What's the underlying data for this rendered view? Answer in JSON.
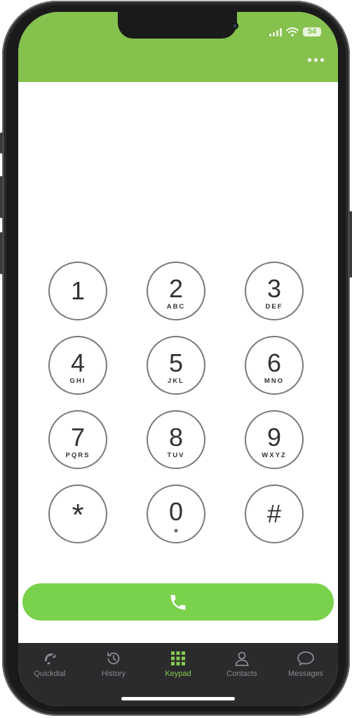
{
  "status_bar": {
    "battery": "54"
  },
  "header": {
    "menu_icon": "more-icon"
  },
  "keypad": {
    "keys": [
      {
        "digit": "1",
        "letters": ""
      },
      {
        "digit": "2",
        "letters": "ABC"
      },
      {
        "digit": "3",
        "letters": "DEF"
      },
      {
        "digit": "4",
        "letters": "GHI"
      },
      {
        "digit": "5",
        "letters": "JKL"
      },
      {
        "digit": "6",
        "letters": "MNO"
      },
      {
        "digit": "7",
        "letters": "PQRS"
      },
      {
        "digit": "8",
        "letters": "TUV"
      },
      {
        "digit": "9",
        "letters": "WXYZ"
      },
      {
        "digit": "*",
        "letters": ""
      },
      {
        "digit": "0",
        "letters": "+"
      },
      {
        "digit": "#",
        "letters": ""
      }
    ]
  },
  "call_button": {
    "icon": "phone-icon",
    "color": "#7ad14b"
  },
  "tabs": [
    {
      "label": "Quickdial",
      "icon": "quickdial-icon"
    },
    {
      "label": "History",
      "icon": "history-icon"
    },
    {
      "label": "Keypad",
      "icon": "keypad-grid-icon",
      "active": true
    },
    {
      "label": "Contacts",
      "icon": "contacts-icon"
    },
    {
      "label": "Messages",
      "icon": "messages-icon"
    }
  ],
  "colors": {
    "header": "#85c14d",
    "accent": "#86c84f",
    "tabbar": "#2b2b2d"
  }
}
